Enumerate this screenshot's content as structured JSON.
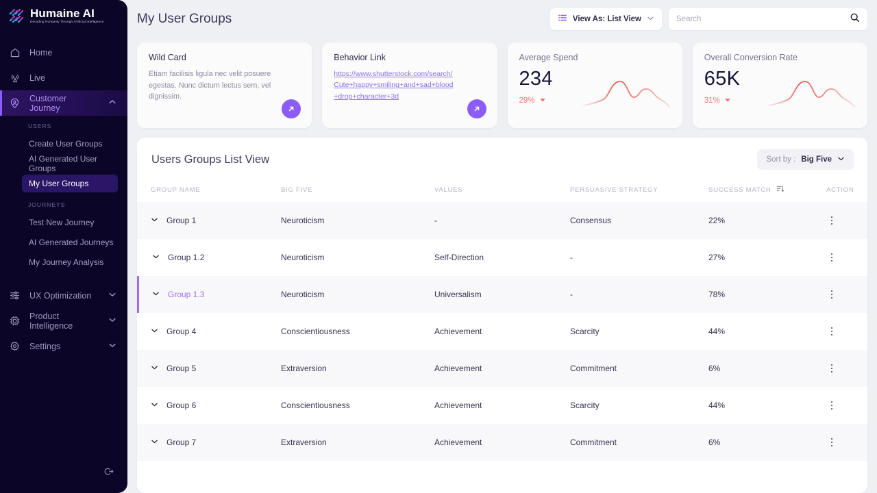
{
  "brand": {
    "title": "Humaine AI",
    "tagline": "Decoding Humanity Through Artificial Intelligence",
    "colors": {
      "accent": "#8b5cf6",
      "sidebar_bg": "#0b0628",
      "highlight": "#9d6cf0",
      "delta": "#ef7a72"
    }
  },
  "sidebar": {
    "items": [
      {
        "label": "Home",
        "icon": "home-icon"
      },
      {
        "label": "Live",
        "icon": "broadcast-icon"
      },
      {
        "label": "Customer Journey",
        "icon": "journey-pin-icon",
        "active": true,
        "chevron": "chevron-up-icon"
      }
    ],
    "sections": [
      {
        "label": "USERS",
        "items": [
          {
            "label": "Create User Groups"
          },
          {
            "label": "AI Generated User Groups"
          },
          {
            "label": "My User Groups",
            "active": true
          }
        ]
      },
      {
        "label": "JOURNEYS",
        "items": [
          {
            "label": "Test New Journey"
          },
          {
            "label": "AI Generated Journeys"
          },
          {
            "label": "My Journey Analysis"
          }
        ]
      }
    ],
    "bottom_items": [
      {
        "label": "UX Optimization",
        "icon": "sliders-icon",
        "chevron": "chevron-down-icon"
      },
      {
        "label": "Product Intelligence",
        "icon": "chip-icon",
        "chevron": "chevron-down-icon"
      },
      {
        "label": "Settings",
        "icon": "gear-icon",
        "chevron": "chevron-down-icon"
      }
    ],
    "logout_icon": "logout-icon"
  },
  "header": {
    "title": "My User Groups",
    "view_as": {
      "label": "View As: List View",
      "icon": "list-icon",
      "chevron": "chevron-down-icon"
    },
    "search": {
      "value": "",
      "placeholder": "Search",
      "icon": "search-icon"
    }
  },
  "cards": [
    {
      "type": "text",
      "title": "Wild Card",
      "body": "Etiam facilisis ligula nec velit posuere egestas. Nunc dictum lectus sem, vel dignissim.",
      "fab_icon": "arrow-up-right-icon"
    },
    {
      "type": "link",
      "title": "Behavior Link",
      "link": "https://www.shutterstock.com/search/Cute+happy+smiling+and+sad+blood+drop+character+3d",
      "fab_icon": "arrow-up-right-icon"
    },
    {
      "type": "metric",
      "title": "Average Spend",
      "value": "234",
      "delta": "29%",
      "delta_direction": "down",
      "delta_icon": "caret-down-icon"
    },
    {
      "type": "metric",
      "title": "Overall Conversion Rate",
      "value": "65K",
      "delta": "31%",
      "delta_direction": "down",
      "delta_icon": "caret-down-icon"
    }
  ],
  "chart_data": [
    {
      "type": "line",
      "title": "Average Spend",
      "x": [
        0,
        1,
        2,
        3,
        4,
        5,
        6,
        7,
        8,
        9
      ],
      "values": [
        8,
        13,
        17,
        38,
        52,
        27,
        40,
        36,
        26,
        12
      ],
      "ylim": [
        0,
        60
      ],
      "grid": false,
      "legend": "none",
      "xlabel": "",
      "ylabel": "",
      "color": "#ef7a72"
    },
    {
      "type": "line",
      "title": "Overall Conversion Rate",
      "x": [
        0,
        1,
        2,
        3,
        4,
        5,
        6,
        7,
        8,
        9
      ],
      "values": [
        8,
        13,
        17,
        38,
        52,
        27,
        40,
        36,
        26,
        12
      ],
      "ylim": [
        0,
        60
      ],
      "grid": false,
      "legend": "none",
      "xlabel": "",
      "ylabel": "",
      "color": "#ef7a72"
    }
  ],
  "panel": {
    "title": "Users Groups List View",
    "sort": {
      "prefix": "Sort by :",
      "value": "Big Five",
      "chevron": "chevron-down-icon"
    },
    "columns": [
      "GROUP NAME",
      "BIG FIVE",
      "VALUES",
      "PERSUASIVE STRATEGY",
      "SUCCESS MATCH",
      "ACTION"
    ],
    "sort_column_icon": "sort-desc-icon",
    "rows": [
      {
        "name": "Group 1",
        "indent": 0,
        "big_five": "Neuroticism",
        "values": "-",
        "strategy": "Consensus",
        "success": "22%",
        "selected": false,
        "alt": true
      },
      {
        "name": "Group 1.2",
        "indent": 1,
        "big_five": "Neuroticism",
        "values": "Self-Direction",
        "strategy": "-",
        "success": "27%",
        "selected": false,
        "alt": false
      },
      {
        "name": "Group 1.3",
        "indent": 1,
        "big_five": "Neuroticism",
        "values": "Universalism",
        "strategy": "-",
        "success": "78%",
        "selected": true,
        "alt": true
      },
      {
        "name": "Group 4",
        "indent": 0,
        "big_five": "Conscientiousness",
        "values": "Achievement",
        "strategy": "Scarcity",
        "success": "44%",
        "selected": false,
        "alt": false
      },
      {
        "name": "Group 5",
        "indent": 0,
        "big_five": "Extraversion",
        "values": "Achievement",
        "strategy": "Commitment",
        "success": "6%",
        "selected": false,
        "alt": true
      },
      {
        "name": "Group 6",
        "indent": 0,
        "big_five": "Conscientiousness",
        "values": "Achievement",
        "strategy": "Scarcity",
        "success": "44%",
        "selected": false,
        "alt": false
      },
      {
        "name": "Group 7",
        "indent": 0,
        "big_five": "Extraversion",
        "values": "Achievement",
        "strategy": "Commitment",
        "success": "6%",
        "selected": false,
        "alt": true
      }
    ],
    "row_chevron_icon": "chevron-down-icon",
    "row_action_icon": "kebab-menu-icon"
  }
}
